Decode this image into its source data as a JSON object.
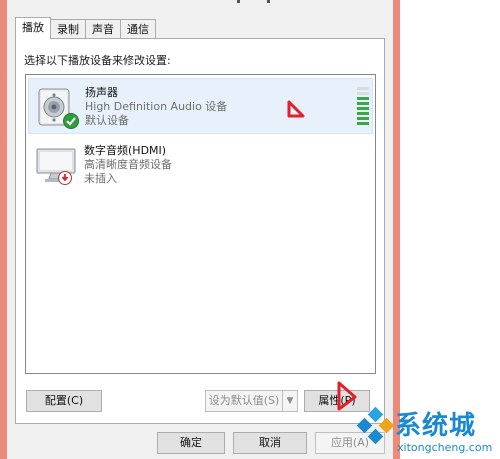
{
  "tabs": [
    {
      "label": "播放"
    },
    {
      "label": "录制"
    },
    {
      "label": "声音"
    },
    {
      "label": "通信"
    }
  ],
  "instruction": "选择以下播放设备来修改设置:",
  "devices": [
    {
      "name": "扬声器",
      "description": "High Definition Audio 设备",
      "status": "默认设备",
      "icon": "speaker-icon",
      "status_icon": "default-check-icon"
    },
    {
      "name": "数字音频(HDMI)",
      "description": "高清晰度音频设备",
      "status": "未插入",
      "icon": "monitor-icon",
      "status_icon": "unplugged-icon"
    }
  ],
  "buttons": {
    "configure": "配置(C)",
    "set_default": "设为默认值(S)",
    "properties": "属性(P)",
    "ok": "确定",
    "cancel": "取消",
    "apply": "应用(A)"
  },
  "watermark": {
    "name": "系统城",
    "url": "xitongcheng.com"
  },
  "colors": {
    "accent_frame": "#e98a7a",
    "level_green": "#3aa845",
    "annotation_red": "#e0202a",
    "logo_blue": "#1a8ad0"
  }
}
